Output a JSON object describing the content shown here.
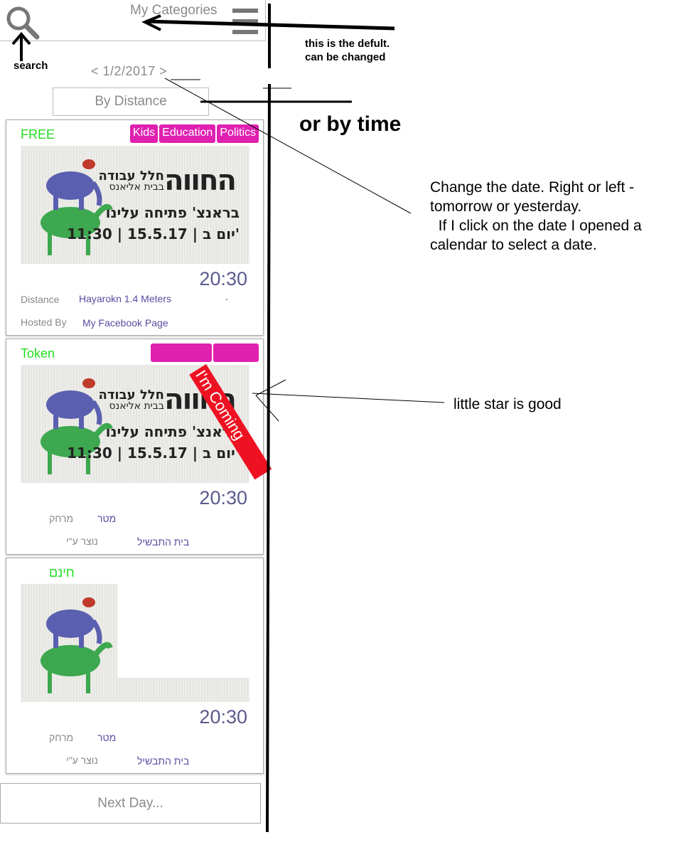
{
  "header": {
    "categories_label": "My Categories",
    "search_icon": "search-icon",
    "menu_icon": "hamburger-icon"
  },
  "date_nav": {
    "text": "< 1/2/2017 >"
  },
  "sort": {
    "label": "By Distance"
  },
  "cards": [
    {
      "price": "FREE",
      "tags": [
        "Kids",
        "Education",
        "Politics"
      ],
      "poster": {
        "line1": "חלל עבודה",
        "line2": "בבית אליאנס",
        "big": "החווה",
        "line3": "בראנצ' פתיחה עלינו",
        "line4": "11:30 | 15.5.17 | יום ב'"
      },
      "time": "20:30",
      "distance_label": "Distance",
      "distance_value": "Hayarokn  1.4 Meters",
      "dot": ".",
      "hosted_label": "Hosted By",
      "hosted_value": "My Facebook Page"
    },
    {
      "price": "Token",
      "ribbon": "I'm Coming",
      "poster": {
        "line1": "חלל עבודה",
        "line2": "בבית אליאנס",
        "big": "החווה",
        "line3": "בראנצ' פתיחה עלינו",
        "line4": "11:30 | 15.5.17 | יום ב'"
      },
      "time": "20:30",
      "distance_label": "מרחק",
      "distance_value": "מטר",
      "hosted_label": "נוצר ע\"י",
      "hosted_value": "בית התבשיל"
    },
    {
      "price": "חינם",
      "time": "20:30",
      "distance_label": "מרחק",
      "distance_value": "מטר",
      "hosted_label": "נוצר ע\"י",
      "hosted_value": "בית התבשיל"
    }
  ],
  "next_day": {
    "label": "Next Day..."
  },
  "annotations": {
    "default_note": "this is the defult.\ncan be changed",
    "search_note": "search",
    "time_note": "or by time",
    "date_note": "Change the date. Right or left -\ntomorrow or yesterday.\n  If I click on the date I opened a\ncalendar to select a date.",
    "star_note": "little star is good"
  }
}
